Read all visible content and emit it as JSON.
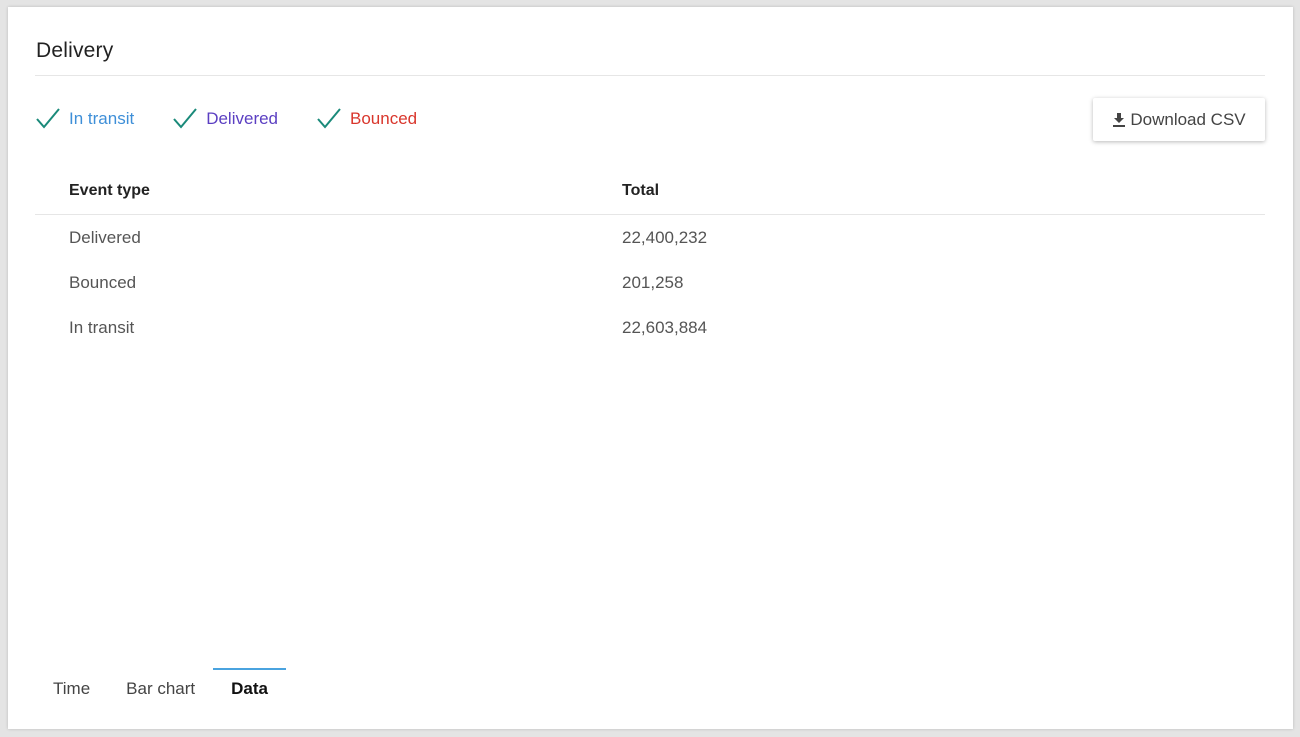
{
  "card": {
    "title": "Delivery"
  },
  "legend": {
    "items": [
      {
        "label": "In transit",
        "color": "#3e8fd8",
        "check_color": "#1a8a7a"
      },
      {
        "label": "Delivered",
        "color": "#5b3fc2",
        "check_color": "#1a8a7a"
      },
      {
        "label": "Bounced",
        "color": "#d9362c",
        "check_color": "#1a8a7a"
      }
    ]
  },
  "download": {
    "label": "Download CSV",
    "icon": "download-icon"
  },
  "table": {
    "headers": [
      "Event type",
      "Total"
    ],
    "rows": [
      [
        "Delivered",
        "22,400,232"
      ],
      [
        "Bounced",
        "201,258"
      ],
      [
        "In transit",
        "22,603,884"
      ]
    ]
  },
  "tabs": {
    "items": [
      {
        "label": "Time"
      },
      {
        "label": "Bar chart"
      },
      {
        "label": "Data"
      }
    ],
    "active": "Data",
    "accent_color": "#4aa3df"
  }
}
